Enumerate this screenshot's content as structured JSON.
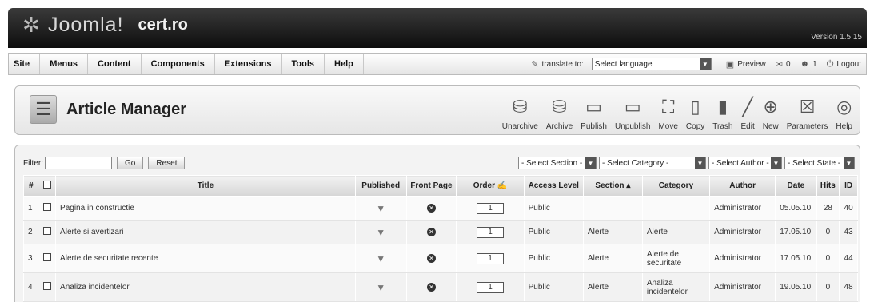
{
  "header": {
    "logo_text": "Joomla!",
    "site_name": "cert.ro",
    "version": "Version 1.5.15"
  },
  "menu": [
    "Site",
    "Menus",
    "Content",
    "Components",
    "Extensions",
    "Tools",
    "Help"
  ],
  "status": {
    "translate_label": "translate to:",
    "language_select": "Select language",
    "preview": "Preview",
    "messages": "0",
    "users": "1",
    "logout": "Logout"
  },
  "page": {
    "title": "Article Manager"
  },
  "toolbar": [
    {
      "label": "Unarchive",
      "icon": "unarchive-icon",
      "glyph": "⛁"
    },
    {
      "label": "Archive",
      "icon": "archive-icon",
      "glyph": "⛁"
    },
    {
      "label": "Publish",
      "icon": "publish-icon",
      "glyph": "▭"
    },
    {
      "label": "Unpublish",
      "icon": "unpublish-icon",
      "glyph": "▭"
    },
    {
      "label": "Move",
      "icon": "move-icon",
      "glyph": "⛶"
    },
    {
      "label": "Copy",
      "icon": "copy-icon",
      "glyph": "▯"
    },
    {
      "label": "Trash",
      "icon": "trash-icon",
      "glyph": "▮"
    },
    {
      "label": "Edit",
      "icon": "edit-icon",
      "glyph": "╱"
    },
    {
      "label": "New",
      "icon": "new-icon",
      "glyph": "⊕"
    },
    {
      "label": "Parameters",
      "icon": "parameters-icon",
      "glyph": "☒"
    },
    {
      "label": "Help",
      "icon": "help-icon",
      "glyph": "◎"
    }
  ],
  "filter": {
    "label": "Filter:",
    "value": "",
    "go": "Go",
    "reset": "Reset",
    "section": "- Select Section -",
    "category": "- Select Category -",
    "author": "- Select Author -",
    "state": "- Select State -"
  },
  "table": {
    "headers": {
      "num": "#",
      "title": "Title",
      "published": "Published",
      "front_page": "Front Page",
      "order": "Order",
      "access": "Access Level",
      "section": "Section",
      "category": "Category",
      "author": "Author",
      "date": "Date",
      "hits": "Hits",
      "id": "ID"
    },
    "rows": [
      {
        "num": "1",
        "title": "Pagina in constructie",
        "order": "1",
        "access": "Public",
        "section": "",
        "category": "",
        "author": "Administrator",
        "date": "05.05.10",
        "hits": "28",
        "id": "40"
      },
      {
        "num": "2",
        "title": "Alerte si avertizari",
        "order": "1",
        "access": "Public",
        "section": "Alerte",
        "category": "Alerte",
        "author": "Administrator",
        "date": "17.05.10",
        "hits": "0",
        "id": "43"
      },
      {
        "num": "3",
        "title": "Alerte de securitate recente",
        "order": "1",
        "access": "Public",
        "section": "Alerte",
        "category": "Alerte de securitate",
        "author": "Administrator",
        "date": "17.05.10",
        "hits": "0",
        "id": "44"
      },
      {
        "num": "4",
        "title": "Analiza incidentelor",
        "order": "1",
        "access": "Public",
        "section": "Alerte",
        "category": "Analiza incidentelor",
        "author": "Administrator",
        "date": "19.05.10",
        "hits": "0",
        "id": "48"
      }
    ]
  }
}
